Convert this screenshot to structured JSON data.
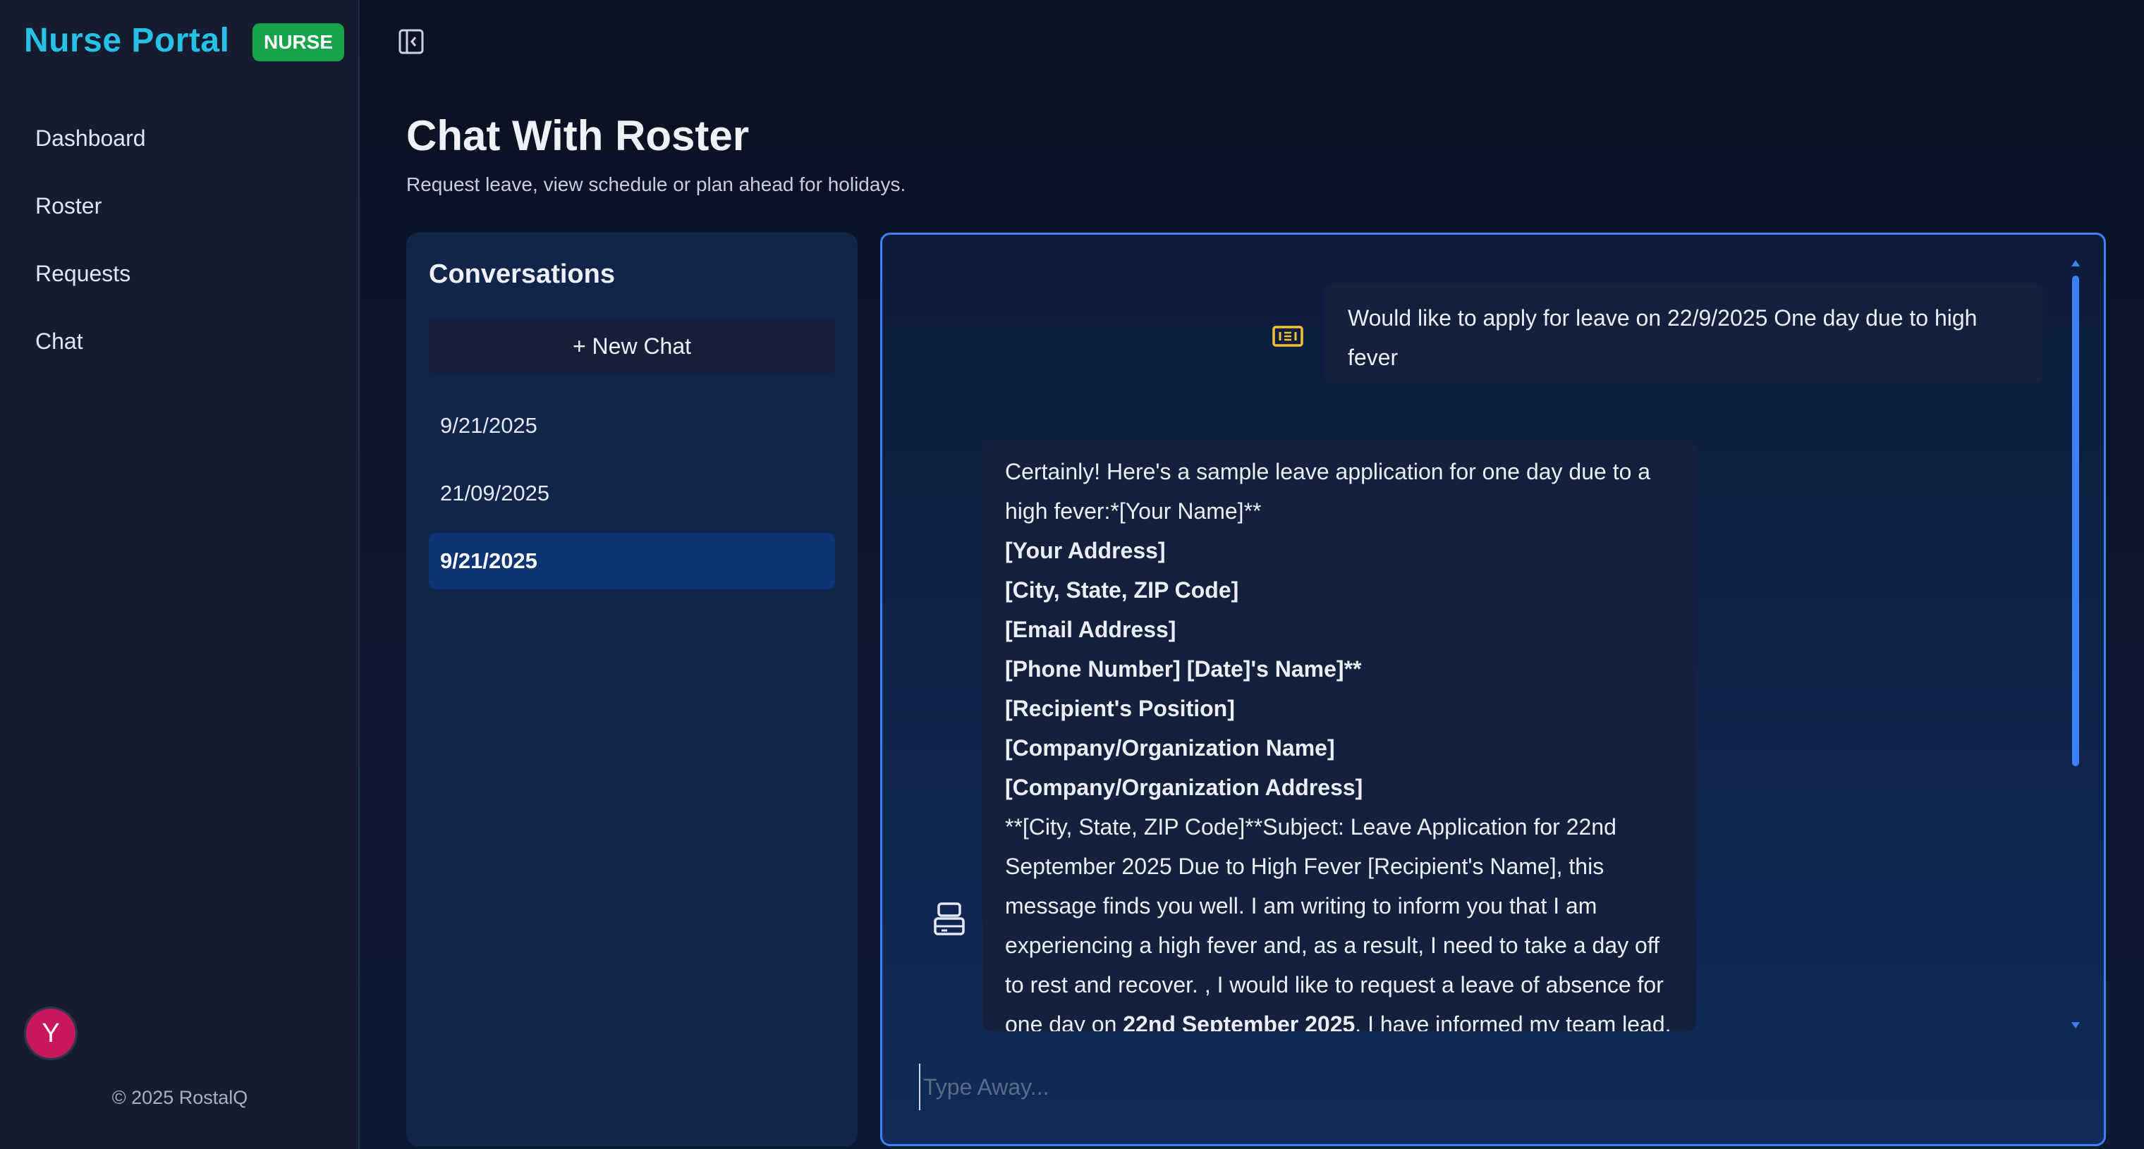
{
  "sidebar": {
    "brand": "Nurse Portal",
    "role_badge": "NURSE",
    "nav": [
      {
        "label": "Dashboard"
      },
      {
        "label": "Roster"
      },
      {
        "label": "Requests"
      },
      {
        "label": "Chat"
      }
    ],
    "avatar_initial": "Y",
    "copyright": "© 2025 RostalQ"
  },
  "header": {
    "title": "Chat With Roster",
    "subtitle": "Request leave, view schedule or plan ahead for holidays."
  },
  "conversations": {
    "title": "Conversations",
    "new_chat_label": "+ New Chat",
    "items": [
      {
        "label": "9/21/2025",
        "active": false
      },
      {
        "label": "21/09/2025",
        "active": false
      },
      {
        "label": "9/21/2025",
        "active": true
      }
    ]
  },
  "chat": {
    "user_message": "Would like to apply for leave on 22/9/2025 One day due to high fever",
    "bot_message": {
      "intro": "Certainly! Here's a sample leave application for one day due to a high fever:*[Your Name]**",
      "lines": [
        "[Your Address]",
        "[City, State, ZIP Code]",
        "[Email Address]",
        "[Phone Number] [Date]'s Name]**",
        "[Recipient's Position]",
        "[Company/Organization Name]",
        "[Company/Organization Address]"
      ],
      "body": "**[City, State, ZIP Code]**Subject: Leave Application for 22nd September 2025 Due to High Fever [Recipient's Name], this message finds you well. I am writing to inform you that I am experiencing a high fever and, as a result, I need to take a day off to rest and recover. , I would like to request a leave of absence for one day on ",
      "body_bold": "22nd September 2025",
      "body_tail": ". I have informed my team lead,"
    },
    "input_placeholder": "Type Away...",
    "icons": {
      "sidebar_toggle": "sidebar-toggle-icon",
      "user": "user-card-icon",
      "bot": "bot-icon"
    }
  },
  "colors": {
    "brand": "#27c0e6",
    "badge": "#16a34a",
    "accent": "#3b82f6",
    "avatar": "#c9175e",
    "active_conversation": "#0d3573"
  }
}
